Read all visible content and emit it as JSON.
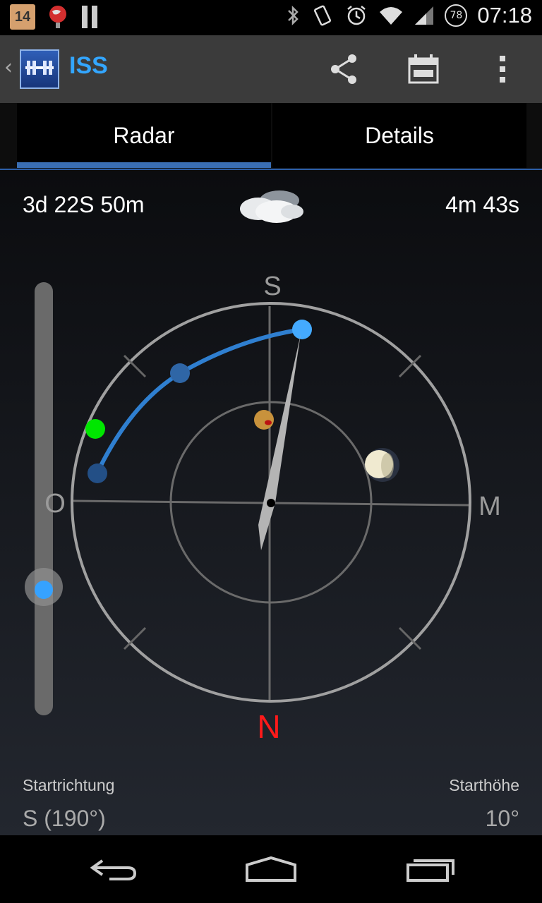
{
  "status_bar": {
    "calendar_day": "14",
    "battery_level": "78",
    "time": "07:18",
    "icons": [
      "calendar-notification-icon",
      "globe-notification-icon",
      "pause-icon",
      "bluetooth-icon",
      "vibrate-icon",
      "alarm-icon",
      "wifi-icon",
      "signal-icon",
      "battery-icon"
    ]
  },
  "action_bar": {
    "title": "ISS",
    "icons": [
      "back-chevron-icon",
      "iss-app-icon",
      "share-icon",
      "calendar-icon",
      "overflow-menu-icon"
    ]
  },
  "tabs": [
    {
      "label": "Radar",
      "selected": true
    },
    {
      "label": "Details",
      "selected": false
    }
  ],
  "radar_view": {
    "time_until": "3d 22S 50m",
    "duration": "4m 43s",
    "weather_icon": "cloudy-icon",
    "compass": {
      "top": "S",
      "right": "M",
      "bottom": "N",
      "left": "O"
    },
    "north_color": "#ff1a1a",
    "track_color": "#2f7fd0",
    "start_marker_color": "#00e600",
    "slider_position": 0.28
  },
  "footer": {
    "start_direction_label": "Startrichtung",
    "start_direction_value": "S (190°)",
    "start_height_label": "Starthöhe",
    "start_height_value": "10°"
  },
  "nav_bar": {
    "icons": [
      "back-icon",
      "home-icon",
      "recent-apps-icon"
    ]
  }
}
